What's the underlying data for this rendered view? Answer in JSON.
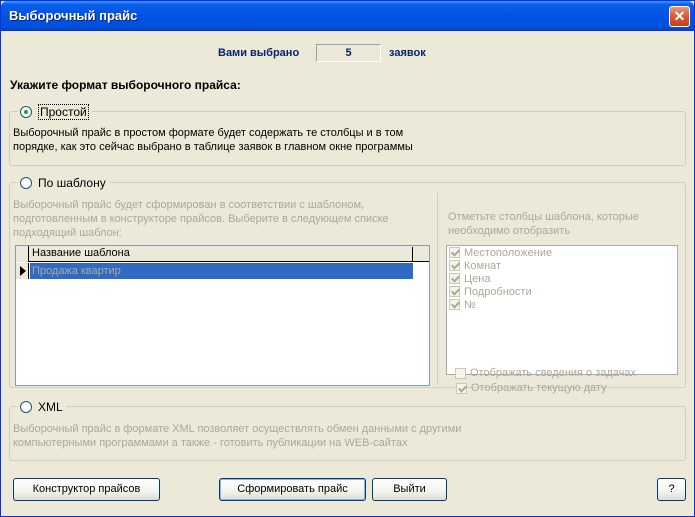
{
  "window": {
    "title": "Выборочный прайс",
    "close_label": "✕"
  },
  "selected": {
    "label": "Вами выбрано",
    "count": "5",
    "suffix": "заявок"
  },
  "format_heading": "Укажите формат выборочного прайса:",
  "simple": {
    "label": "Простой",
    "checked": true,
    "desc_line1": "Выборочный прайс в простом формате будет содержать те столбцы и в том",
    "desc_line2": "порядке, как это сейчас выбрано в таблице заявок в главном окне программы"
  },
  "template": {
    "label": "По шаблону",
    "checked": false,
    "desc_line1": "Выборочный прайс будет сформирован в соответствии с шаблоном,",
    "desc_line2": "подготовленным в конструкторе прайсов. Выберите в следующем списке",
    "desc_line3": "подходящий шаблон:",
    "grid_header": "Название шаблона",
    "grid_rows": [
      "Продажа квартир"
    ],
    "columns_hint_line1": "Отметьте столбцы шаблона, которые",
    "columns_hint_line2": "необходимо отобразить",
    "columns": [
      {
        "label": "Местоположение",
        "checked": true
      },
      {
        "label": "Комнат",
        "checked": true
      },
      {
        "label": "Цена",
        "checked": true
      },
      {
        "label": "Подробности",
        "checked": true
      },
      {
        "label": "№",
        "checked": true
      }
    ],
    "show_date": {
      "label": "Отображать текущую дату",
      "checked": true
    },
    "show_tasks": {
      "label": "Отображать сведения о задачах",
      "checked": false
    }
  },
  "xml": {
    "label": "XML",
    "checked": false,
    "desc_line1": "Выборочный прайс в формате XML позволяет осуществлять обмен данными с другими",
    "desc_line2": "компьютерными программами а также - готовить публикации на WEB-сайтах"
  },
  "buttons": {
    "constructor": "Конструктор прайсов",
    "generate": "Сформировать прайс",
    "exit": "Выйти",
    "help": "?"
  }
}
